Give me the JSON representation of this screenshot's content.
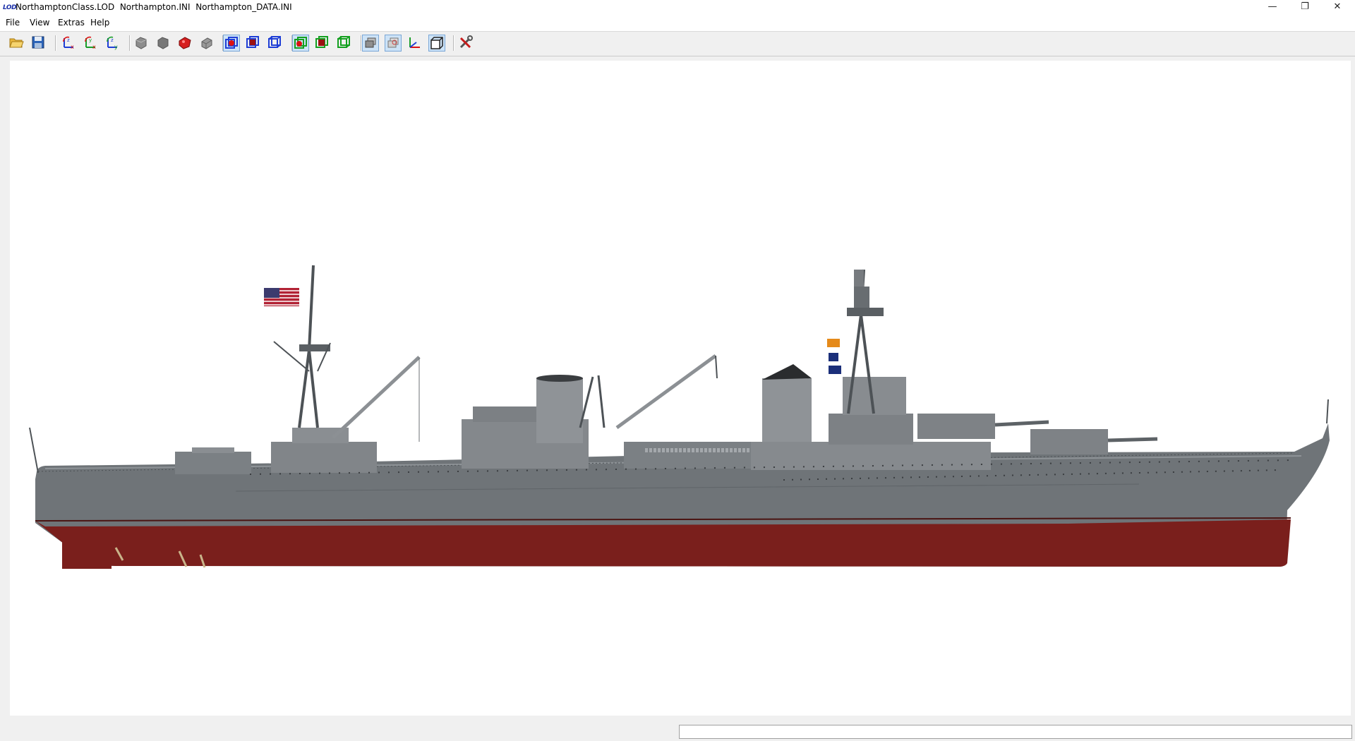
{
  "window": {
    "title": "NorthamptonClass.LOD  Northampton.INI  Northampton_DATA.INI",
    "logo": "LOD",
    "controls": {
      "minimize": "—",
      "maximize": "❐",
      "close": "✕"
    }
  },
  "menu": {
    "items": [
      "File",
      "View",
      "Extras",
      "Help"
    ]
  },
  "toolbar": {
    "buttons": [
      {
        "icon": "open-folder-icon",
        "pressed": false
      },
      {
        "icon": "save-disk-icon",
        "pressed": false
      },
      {
        "icon": "rotate-axes-zx-icon",
        "pressed": false
      },
      {
        "icon": "rotate-axes-yx-icon",
        "pressed": false
      },
      {
        "icon": "rotate-axes-zy-icon",
        "pressed": false
      },
      {
        "icon": "solid-shaded-gray-icon",
        "pressed": false
      },
      {
        "icon": "solid-flat-gray-icon",
        "pressed": false
      },
      {
        "icon": "solid-red-icon",
        "pressed": false
      },
      {
        "icon": "solid-gray-block-icon",
        "pressed": false
      },
      {
        "icon": "wireframe-blue-red-icon",
        "pressed": true
      },
      {
        "icon": "wireframe-blue-solid-icon",
        "pressed": false
      },
      {
        "icon": "wireframe-blue-cube-icon",
        "pressed": false
      },
      {
        "icon": "wireframe-green-red-icon",
        "pressed": true
      },
      {
        "icon": "wireframe-green-solid-icon",
        "pressed": false
      },
      {
        "icon": "wireframe-green-cube-icon",
        "pressed": false
      },
      {
        "icon": "layers-stack-icon",
        "pressed": true
      },
      {
        "icon": "texture-layers-icon",
        "pressed": true
      },
      {
        "icon": "coordinate-axes-icon",
        "pressed": false
      },
      {
        "icon": "bounding-box-icon",
        "pressed": true
      },
      {
        "icon": "tools-settings-icon",
        "pressed": false
      }
    ]
  },
  "viewport": {
    "subject": "heavy-cruiser-3d-model-side-view"
  },
  "status": {
    "text": ""
  },
  "colors": {
    "hull": "#6f7478",
    "hull_dark": "#55595d",
    "waterline_red": "#7a1f1c",
    "superstructure": "#8a8e92",
    "mast": "#4d5256",
    "accent_blue": "#1f3fd6"
  }
}
